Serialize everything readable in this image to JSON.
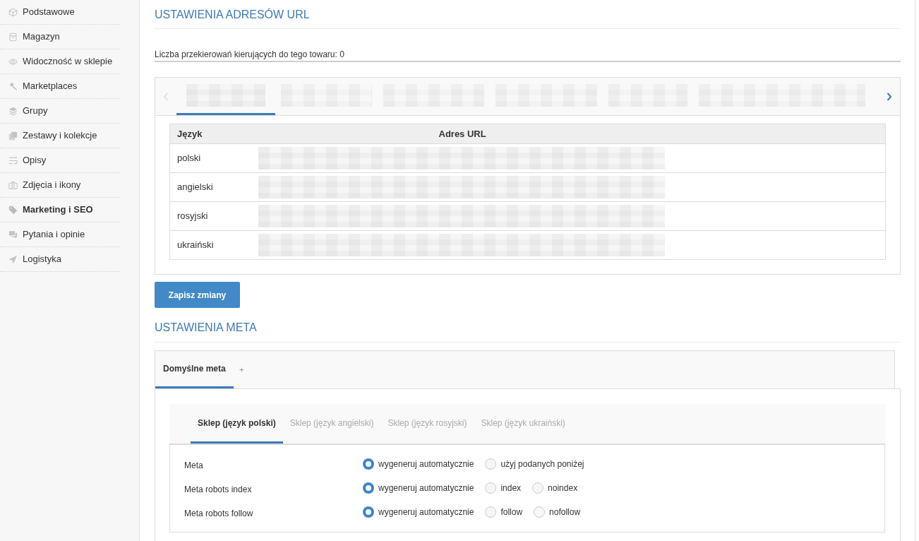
{
  "sidebar": {
    "items": [
      {
        "label": "Podstawowe",
        "selected": false
      },
      {
        "label": "Magazyn",
        "selected": false
      },
      {
        "label": "Widoczność w sklepie",
        "selected": false
      },
      {
        "label": "Marketplaces",
        "selected": false
      },
      {
        "label": "Grupy",
        "selected": false
      },
      {
        "label": "Zestawy i kolekcje",
        "selected": false
      },
      {
        "label": "Opisy",
        "selected": false
      },
      {
        "label": "Zdjęcia i ikony",
        "selected": false
      },
      {
        "label": "Marketing i SEO",
        "selected": true
      },
      {
        "label": "Pytania i opinie",
        "selected": false
      },
      {
        "label": "Logistyka",
        "selected": false
      }
    ]
  },
  "url_section": {
    "title": "USTAWIENIA ADRESÓW URL",
    "redirect_count": "Liczba przekierowań kierujących do tego towaru: 0",
    "tab_scroll": {
      "back_disabled": true,
      "forward_disabled": false
    },
    "tabs": [
      {
        "selected": true
      },
      {
        "selected": false
      },
      {
        "selected": false
      },
      {
        "selected": false
      },
      {
        "selected": false
      },
      {
        "selected": false
      }
    ],
    "table": {
      "columns": [
        "Język",
        "Adres URL"
      ],
      "rows": [
        {
          "language": "polski"
        },
        {
          "language": "angielski"
        },
        {
          "language": "rosyjski"
        },
        {
          "language": "ukraiński"
        }
      ]
    },
    "save_button": "Zapisz zmiany"
  },
  "meta_section": {
    "title": "USTAWIENIA META",
    "tabs": [
      {
        "label": "Domyślne meta",
        "selected": true
      }
    ],
    "add_tab": "+",
    "store_tabs": [
      {
        "label": "Sklep (język polski)",
        "selected": true
      },
      {
        "label": "Sklep (język angielski)",
        "selected": false
      },
      {
        "label": "Sklep (język rosyjski)",
        "selected": false
      },
      {
        "label": "Sklep (język ukraiński)",
        "selected": false
      }
    ],
    "fields": [
      {
        "label": "Meta",
        "options": [
          {
            "label": "wygeneruj automatycznie",
            "selected": true
          },
          {
            "label": "użyj podanych poniżej",
            "selected": false
          }
        ]
      },
      {
        "label": "Meta robots index",
        "options": [
          {
            "label": "wygeneruj automatycznie",
            "selected": true
          },
          {
            "label": "index",
            "selected": false
          },
          {
            "label": "noindex",
            "selected": false
          }
        ]
      },
      {
        "label": "Meta robots follow",
        "options": [
          {
            "label": "wygeneruj automatycznie",
            "selected": true
          },
          {
            "label": "follow",
            "selected": false
          },
          {
            "label": "nofollow",
            "selected": false
          }
        ]
      }
    ]
  }
}
